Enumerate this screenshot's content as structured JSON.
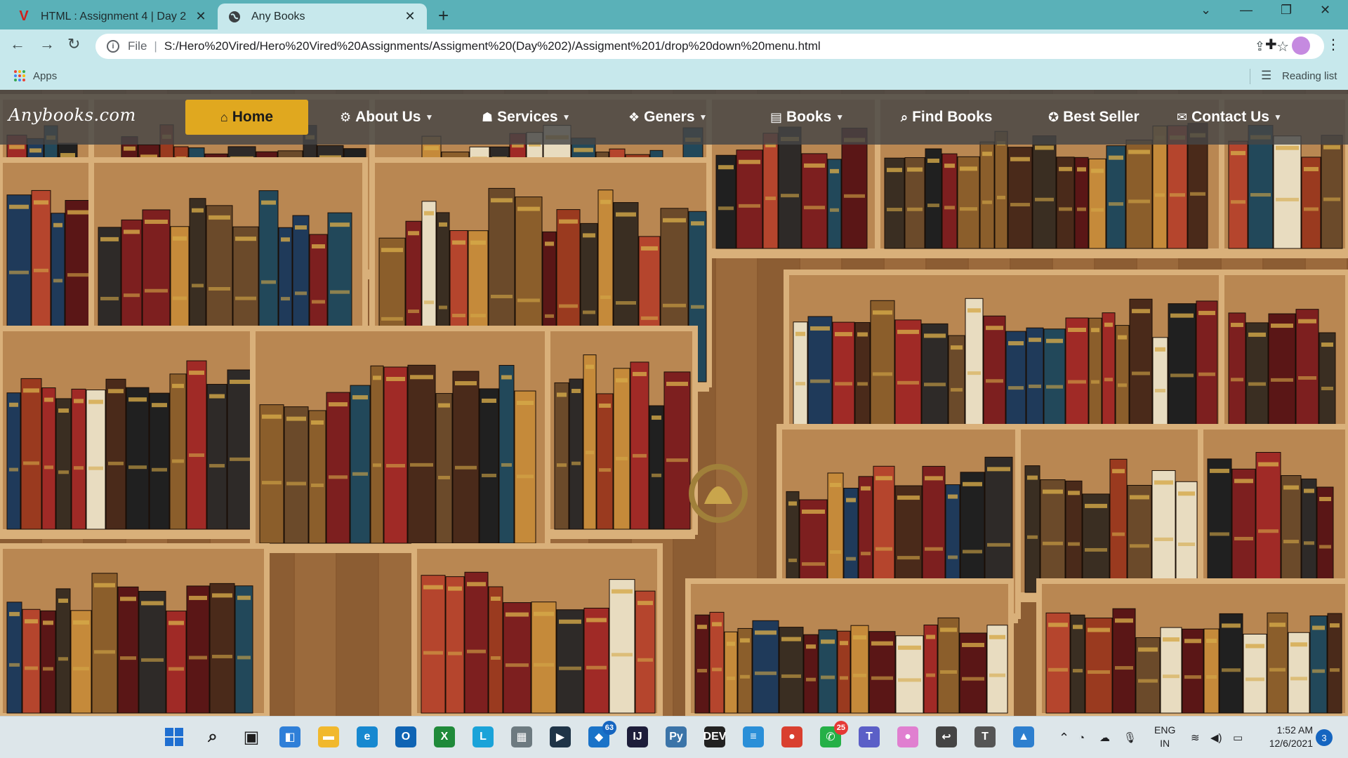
{
  "browser": {
    "tabs": [
      {
        "title": "HTML : Assignment 4 | Day 2",
        "favicon": "vired-logo-icon",
        "close": "✕"
      },
      {
        "title": "Any Books",
        "favicon": "globe-icon",
        "close": "✕"
      }
    ],
    "new_tab": "+",
    "window_controls": {
      "tab_search": "⌄",
      "minimize": "—",
      "restore": "❐",
      "close": "✕"
    },
    "address": {
      "scheme": "File",
      "separator": "|",
      "url": "S:/Hero%20Vired/Hero%20Vired%20Assignments/Assigment%20(Day%202)/Assigment%201/drop%20down%20menu.html"
    },
    "bookmarks": {
      "apps_label": "Apps",
      "reading_list": "Reading list"
    }
  },
  "page": {
    "brand": "Anybooks.com",
    "nav": [
      {
        "label": "Home",
        "icon": "home-icon",
        "glyph": "⌂",
        "has_caret": false,
        "active": true
      },
      {
        "label": "About Us",
        "icon": "gear-icon",
        "glyph": "⚙",
        "has_caret": true,
        "active": false
      },
      {
        "label": "Services",
        "icon": "hands-icon",
        "glyph": "☗",
        "has_caret": true,
        "active": false
      },
      {
        "label": "Geners",
        "icon": "masks-icon",
        "glyph": "❖",
        "has_caret": true,
        "active": false
      },
      {
        "label": "Books",
        "icon": "book-icon",
        "glyph": "▤",
        "has_caret": true,
        "active": false
      },
      {
        "label": "Find Books",
        "icon": "search-book-icon",
        "glyph": "⌕",
        "has_caret": false,
        "active": false
      },
      {
        "label": "Best Seller",
        "icon": "award-icon",
        "glyph": "✪",
        "has_caret": false,
        "active": false
      },
      {
        "label": "Contact Us",
        "icon": "handshake-icon",
        "glyph": "✉",
        "has_caret": true,
        "active": false
      }
    ],
    "caret": "▼",
    "colors": {
      "nav_active_bg": "#e0a81f",
      "nav_bar_bg": "#464646",
      "chrome_accent": "#5ab1b8"
    }
  },
  "taskbar": {
    "apps": [
      {
        "name": "windows-start-icon",
        "label": "",
        "color": "#1f6fd1",
        "badge": ""
      },
      {
        "name": "search-icon",
        "label": "⌕",
        "color": "#2b2b2b",
        "badge": ""
      },
      {
        "name": "task-view-icon",
        "label": "▣",
        "color": "#2b2b2b",
        "badge": ""
      },
      {
        "name": "widgets-icon",
        "label": "◧",
        "color": "#2f7fd8",
        "badge": ""
      },
      {
        "name": "file-explorer-icon",
        "label": "▬",
        "color": "#f1b82d",
        "badge": ""
      },
      {
        "name": "edge-icon",
        "label": "e",
        "color": "#1688d0",
        "badge": ""
      },
      {
        "name": "outlook-icon",
        "label": "O",
        "color": "#0f64b4",
        "badge": ""
      },
      {
        "name": "xbox-icon",
        "label": "X",
        "color": "#1f8a3a",
        "badge": ""
      },
      {
        "name": "l-app-icon",
        "label": "L",
        "color": "#1aa3d9",
        "badge": ""
      },
      {
        "name": "pc-manager-icon",
        "label": "▦",
        "color": "#6d7a80",
        "badge": ""
      },
      {
        "name": "prime-video-icon",
        "label": "▶",
        "color": "#1f3447",
        "badge": ""
      },
      {
        "name": "store-icon",
        "label": "◆",
        "color": "#1a73c8",
        "badge": "63"
      },
      {
        "name": "intellij-icon",
        "label": "IJ",
        "color": "#1d1d3a",
        "badge": ""
      },
      {
        "name": "python-icon",
        "label": "Py",
        "color": "#3b74a8",
        "badge": ""
      },
      {
        "name": "dev-icon",
        "label": "DEV",
        "color": "#222222",
        "badge": ""
      },
      {
        "name": "notepad-icon",
        "label": "≡",
        "color": "#2a8fd8",
        "badge": ""
      },
      {
        "name": "chrome-icon",
        "label": "●",
        "color": "#d93f2f",
        "badge": ""
      },
      {
        "name": "whatsapp-icon",
        "label": "✆",
        "color": "#25b047",
        "badge": "25"
      },
      {
        "name": "teams-icon",
        "label": "T",
        "color": "#5b5fc7",
        "badge": ""
      },
      {
        "name": "chrome-profile-icon",
        "label": "●",
        "color": "#e07fd0",
        "badge": ""
      },
      {
        "name": "back-app-icon",
        "label": "↩",
        "color": "#444444",
        "badge": ""
      },
      {
        "name": "typora-icon",
        "label": "T",
        "color": "#555555",
        "badge": ""
      },
      {
        "name": "photos-icon",
        "label": "▲",
        "color": "#2d7fcf",
        "badge": ""
      }
    ],
    "tray": {
      "chevron": "⌃",
      "lang_top": "ENG",
      "lang_bottom": "IN",
      "time": "1:52 AM",
      "date": "12/6/2021",
      "notifications": "3"
    }
  }
}
